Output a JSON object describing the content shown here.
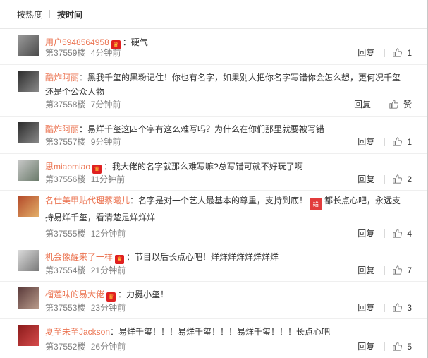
{
  "sort": {
    "by_hot": "按热度",
    "by_time": "按时间"
  },
  "comments": [
    {
      "user": "用户5948564958",
      "text": "：硬气",
      "floor": "第37559楼",
      "time": "4分钟前",
      "reply": "回复",
      "likes": "1"
    },
    {
      "user": "酷炸阿丽",
      "text": "：黑我千玺的黑粉记住！你也有名字，如果别人把你名字写错你会怎么想，更何况千玺还是个公众人物",
      "floor": "第37558楼",
      "time": "7分钟前",
      "reply": "回复",
      "likes": "赞"
    },
    {
      "user": "酷炸阿丽",
      "text": "：易烊千玺这四个字有这么难写吗？为什么在你们那里就要被写错",
      "floor": "第37557楼",
      "time": "9分钟前",
      "reply": "回复",
      "likes": "1"
    },
    {
      "user": "思miaomiao",
      "text": "：我大佬的名字就那么难写嘛?总写错可就不好玩了啊",
      "floor": "第37556楼",
      "time": "11分钟前",
      "reply": "回复",
      "likes": "2"
    },
    {
      "user": "名仕美甲贴代理蔡曦儿",
      "text": "：名字是对一个艺人最基本的尊重，支持到底！",
      "emoji": "给",
      "text2": "都长点心吧，永远支持易烊千玺，看清楚是烊烊烊",
      "floor": "第37555楼",
      "time": "12分钟前",
      "reply": "回复",
      "likes": "4"
    },
    {
      "user": "机会像醒来了一样",
      "text": "：节目以后长点心吧！烊烊烊烊烊烊烊烊",
      "floor": "第37554楼",
      "time": "21分钟前",
      "reply": "回复",
      "likes": "7"
    },
    {
      "user": "榴莲味的易大佬",
      "text": "：力挺小玺！",
      "floor": "第37553楼",
      "time": "23分钟前",
      "reply": "回复",
      "likes": "3"
    },
    {
      "user": "夏至未至Jackson",
      "text": "：易烊千玺！！！易烊千玺！！！易烊千玺！！！长点心吧",
      "floor": "第37552楼",
      "time": "26分钟前",
      "reply": "回复",
      "likes": "5"
    }
  ]
}
